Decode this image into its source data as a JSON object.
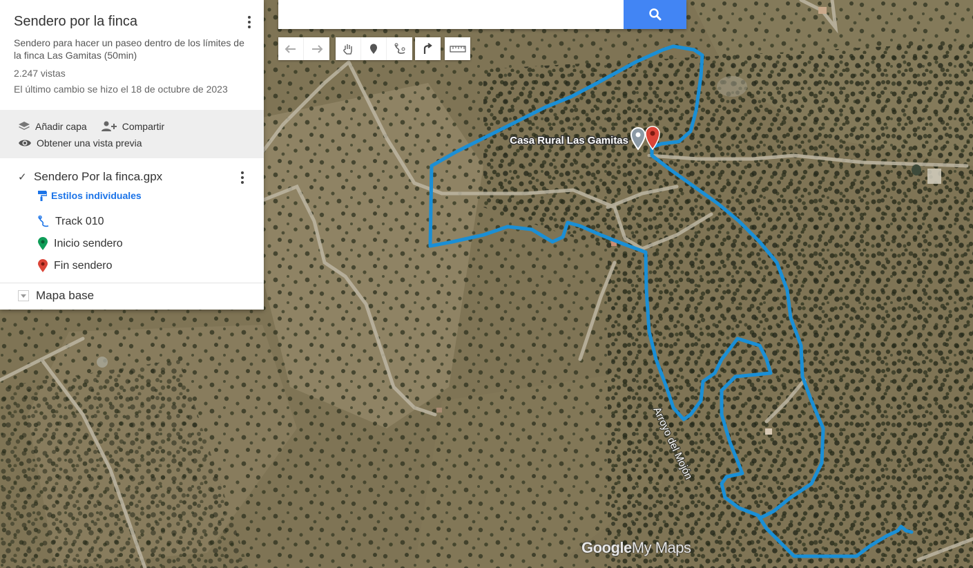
{
  "search": {
    "value": "",
    "placeholder": ""
  },
  "map_info": {
    "title": "Sendero por la finca",
    "description": "Sendero para hacer un paseo dentro de los límites de la finca Las Gamitas (50min)",
    "views": "2.247 vistas",
    "last_change": "El último cambio se hizo el 18 de octubre de 2023"
  },
  "actions": {
    "add_layer": "Añadir capa",
    "share": "Compartir",
    "preview": "Obtener una vista previa"
  },
  "layer": {
    "name": "Sendero Por la finca.gpx",
    "checked": true,
    "styles_label": "Estilos individuales",
    "features": [
      {
        "label": "Track 010",
        "icon": "line-track-icon",
        "color": "#1a73e8"
      },
      {
        "label": "Inicio sendero",
        "icon": "green-pin-icon",
        "color": "#0f9d58"
      },
      {
        "label": "Fin sendero",
        "icon": "red-pin-icon",
        "color": "#db4437"
      }
    ]
  },
  "basemap": {
    "label": "Mapa base"
  },
  "map": {
    "place_label": "Casa Rural Las Gamitas",
    "stream_label": "Arroyo del Mojón",
    "watermark_brand": "Google",
    "watermark_product": "My Maps",
    "route_color": "#1a8fd6"
  },
  "toolbar_icons": [
    "undo-icon",
    "redo-icon",
    "hand-pan-icon",
    "add-marker-icon",
    "draw-line-icon",
    "directions-icon",
    "measure-ruler-icon"
  ]
}
